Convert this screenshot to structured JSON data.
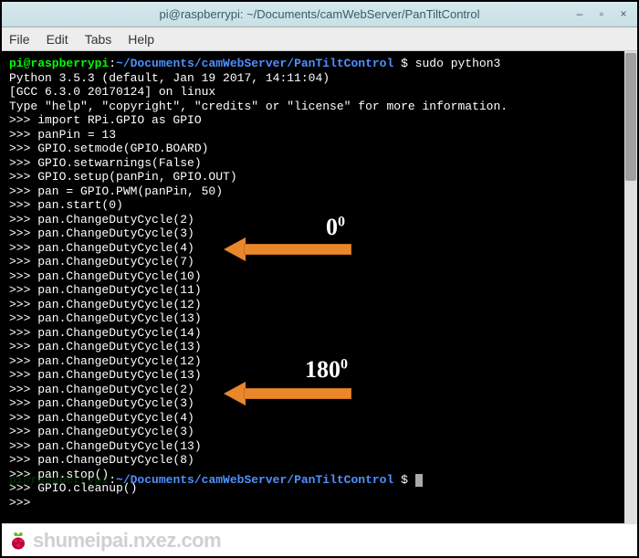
{
  "window": {
    "title": "pi@raspberrypi: ~/Documents/camWebServer/PanTiltControl"
  },
  "menu": {
    "items": [
      "File",
      "Edit",
      "Tabs",
      "Help"
    ]
  },
  "terminal": {
    "prompt_user": "pi@raspberrypi",
    "prompt_sep": ":",
    "prompt_path": "~/Documents/camWebServer/PanTiltControl",
    "prompt_dollar": " $ ",
    "command": "sudo python3",
    "lines": [
      "Python 3.5.3 (default, Jan 19 2017, 14:11:04)",
      "[GCC 6.3.0 20170124] on linux",
      "Type \"help\", \"copyright\", \"credits\" or \"license\" for more information.",
      ">>> import RPi.GPIO as GPIO",
      ">>> panPin = 13",
      ">>> GPIO.setmode(GPIO.BOARD)",
      ">>> GPIO.setwarnings(False)",
      ">>> GPIO.setup(panPin, GPIO.OUT)",
      ">>> pan = GPIO.PWM(panPin, 50)",
      ">>> pan.start(0)",
      ">>> pan.ChangeDutyCycle(2)",
      ">>> pan.ChangeDutyCycle(3)",
      ">>> pan.ChangeDutyCycle(4)",
      ">>> pan.ChangeDutyCycle(7)",
      ">>> pan.ChangeDutyCycle(10)",
      ">>> pan.ChangeDutyCycle(11)",
      ">>> pan.ChangeDutyCycle(12)",
      ">>> pan.ChangeDutyCycle(13)",
      ">>> pan.ChangeDutyCycle(14)",
      ">>> pan.ChangeDutyCycle(13)",
      ">>> pan.ChangeDutyCycle(12)",
      ">>> pan.ChangeDutyCycle(13)",
      ">>> pan.ChangeDutyCycle(2)",
      ">>> pan.ChangeDutyCycle(3)",
      ">>> pan.ChangeDutyCycle(4)",
      ">>> pan.ChangeDutyCycle(3)",
      ">>> pan.ChangeDutyCycle(13)",
      ">>> pan.ChangeDutyCycle(8)",
      ">>> pan.stop()",
      ">>> GPIO.cleanup()",
      ">>>"
    ],
    "prompt2_prefix": "pi@raspberrypi",
    "prompt2_path": "~/Documents/camWebServer/PanTiltControl",
    "prompt2_dollar": " $ "
  },
  "annotations": {
    "label1_main": "0",
    "label1_sup": "0",
    "label2_main": "180",
    "label2_sup": "0"
  },
  "watermark": {
    "text": "shumeipai.nxez.com"
  }
}
